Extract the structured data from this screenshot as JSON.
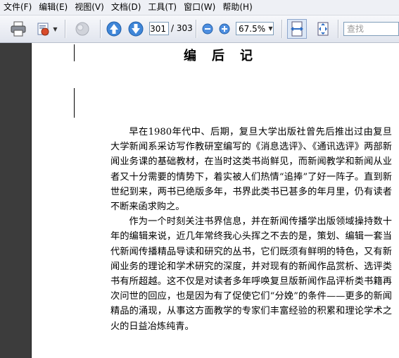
{
  "menu": [
    "文件(F)",
    "编辑(E)",
    "视图(V)",
    "文档(D)",
    "工具(T)",
    "窗口(W)",
    "帮助(H)"
  ],
  "toolbar": {
    "current_page": "301",
    "total_pages": "/ 303",
    "zoom": "67.5%",
    "search_placeholder": "查找"
  },
  "document": {
    "title": "编后记",
    "paragraphs": [
      "早在1980年代中、后期，复旦大学出版社曾先后推出过由复旦大学新闻系采访写作教研室编写的《消息选评》、《通讯选评》两部新闻业务课的基础教材，在当时这类书尚鲜见，而新闻教学和新闻从业者又十分需要的情势下，着实被人们热情“追捧”了好一阵子。直到新世纪到来，两书已绝版多年，书界此类书已甚多的年月里，仍有读者不断来函求购之。",
      "作为一个时刻关注书界信息，并在新闻传播学出版领域操持数十年的编辑来说，近几年常终我心头挥之不去的是，策划、编辑一套当代新闻传播精品导读和研究的丛书，它们既须有鲜明的特色，又有新闻业务的理论和学术研究的深度，并对现有的新闻作品赏析、选评类书有所超越。这不仅是对读者多年呼唤复旦版新闻作品评析类书籍再次问世的回应，也是因为有了促使它们“分娩”的条件——更多的新闻精品的涌现，从事这方面教学的专家们丰富经验的积累和理论学术之火的日益冶炼纯青。"
    ]
  }
}
